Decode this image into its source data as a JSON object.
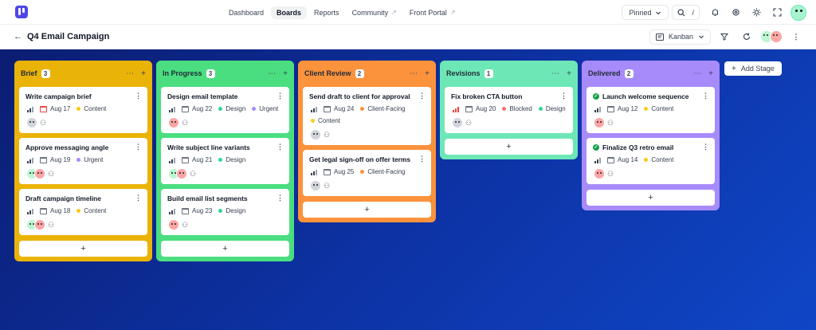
{
  "nav": {
    "items": [
      {
        "label": "Dashboard"
      },
      {
        "label": "Boards"
      },
      {
        "label": "Reports"
      },
      {
        "label": "Community",
        "ext": "↗"
      },
      {
        "label": "Front Portal",
        "ext": "↗"
      }
    ],
    "pinned_label": "Pinned",
    "search_shortcut": "/"
  },
  "header": {
    "back_icon": "←",
    "title": "Q4 Email Campaign",
    "view_label": "Kanban"
  },
  "columns": [
    {
      "title": "Brief",
      "count": "3",
      "color": "#eab308",
      "cards": [
        {
          "title": "Write campaign brief",
          "date": "Aug 17",
          "tags": [
            "Content"
          ],
          "date_red": true
        },
        {
          "title": "Approve messaging angle",
          "date": "Aug 19",
          "tags": [
            "Urgent"
          ]
        },
        {
          "title": "Draft campaign timeline",
          "date": "Aug 18",
          "tags": [
            "Content"
          ]
        }
      ]
    },
    {
      "title": "In Progress",
      "count": "3",
      "color": "#4ade80",
      "cards": [
        {
          "title": "Design email template",
          "date": "Aug 22",
          "tags": [
            "Design",
            "Urgent"
          ]
        },
        {
          "title": "Write subject line variants",
          "date": "Aug 21",
          "tags": [
            "Design"
          ]
        },
        {
          "title": "Build email list segments",
          "date": "Aug 23",
          "tags": [
            "Design"
          ]
        }
      ]
    },
    {
      "title": "Client Review",
      "count": "2",
      "color": "#fb923c",
      "cards": [
        {
          "title": "Send draft to client for approval",
          "date": "Aug 24",
          "tags": [
            "Client-Facing",
            "Content"
          ]
        },
        {
          "title": "Get legal sign-off on offer terms",
          "date": "Aug 25",
          "tags": [
            "Client-Facing"
          ]
        }
      ]
    },
    {
      "title": "Revisions",
      "count": "1",
      "color": "#6ee7b7",
      "cards": [
        {
          "title": "Fix broken CTA button",
          "date": "Aug 20",
          "tags": [
            "Blocked",
            "Design"
          ]
        }
      ]
    },
    {
      "title": "Delivered",
      "count": "2",
      "color": "#a78bfa",
      "cards": [
        {
          "title": "Launch welcome sequence",
          "date": "Aug 12",
          "tags": [
            "Content"
          ]
        },
        {
          "title": "Finalize Q3 retro email",
          "date": "Aug 14",
          "tags": [
            "Content"
          ]
        }
      ]
    }
  ],
  "tag_colors": {
    "Content": "#facc15",
    "Urgent": "#a78bfa",
    "Design": "#34d399",
    "Client-Facing": "#fb923c",
    "Blocked": "#f87171"
  },
  "add_card_label": "+",
  "add_stage_label": "Add Stage"
}
